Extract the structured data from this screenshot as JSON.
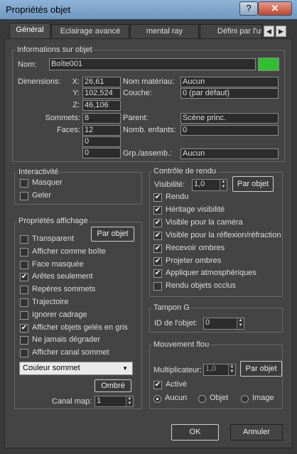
{
  "window": {
    "title": "Propriétés objet",
    "help_label": "?",
    "close_label": "✕"
  },
  "tabs": [
    {
      "label": "Général"
    },
    {
      "label": "Eclairage avancé"
    },
    {
      "label": "mental ray"
    },
    {
      "label": "Défini par l'ut"
    }
  ],
  "tab_scroll": {
    "left": "◀",
    "right": "▶"
  },
  "info": {
    "legend": "Informations sur objet",
    "name_label": "Nom:",
    "name_value": "Boîte001",
    "object_color": "#30c030",
    "dimensions_label": "Dimensions:",
    "x_label": "X:",
    "x_value": "26,61",
    "y_label": "Y:",
    "y_value": "102,524",
    "z_label": "Z:",
    "z_value": "46,106",
    "vertices_label": "Sommets:",
    "vertices_value": "8",
    "faces_label": "Faces:",
    "faces_value": "12",
    "extra1_value": "0",
    "extra2_value": "0",
    "material_label": "Nom matériau:",
    "material_value": "Aucun",
    "layer_label": "Couche:",
    "layer_value": "0 (par défaut)",
    "parent_label": "Parent:",
    "parent_value": "Scène princ.",
    "children_label": "Nomb. enfants:",
    "children_value": "0",
    "group_label": "Grp./assemb.:",
    "group_value": "Aucun"
  },
  "interactivity": {
    "legend": "Interactivité",
    "items": [
      {
        "label": "Masquer",
        "checked": false
      },
      {
        "label": "Geler",
        "checked": false
      }
    ]
  },
  "display": {
    "legend": "Propriétés affichage",
    "by_object_label": "Par objet",
    "items": [
      {
        "label": "Transparent",
        "checked": false
      },
      {
        "label": "Afficher comme boîte",
        "checked": false
      },
      {
        "label": "Face masquée",
        "checked": false
      },
      {
        "label": "Arêtes seulement",
        "checked": true
      },
      {
        "label": "Repères sommets",
        "checked": false
      },
      {
        "label": "Trajectoire",
        "checked": false
      },
      {
        "label": "Ignorer cadrage",
        "checked": false
      },
      {
        "label": "Afficher objets gelés en gris",
        "checked": true
      },
      {
        "label": "Ne jamais dégrader",
        "checked": false
      },
      {
        "label": "Afficher canal sommet",
        "checked": false
      }
    ],
    "vertex_channel_selected": "Couleur sommet",
    "shaded_label": "Ombré",
    "map_channel_label": "Canal map:",
    "map_channel_value": "1"
  },
  "render": {
    "legend": "Contrôle de rendu",
    "visibility_label": "Visibilité:",
    "visibility_value": "1,0",
    "by_object_label": "Par objet",
    "items": [
      {
        "label": "Rendu",
        "checked": true
      },
      {
        "label": "Héritage visibilité",
        "checked": true
      },
      {
        "label": "Visible pour la caméra",
        "checked": true
      },
      {
        "label": "Visible pour la réflexion/réfraction",
        "checked": true
      },
      {
        "label": "Recevoir ombres",
        "checked": true
      },
      {
        "label": "Projeter ombres",
        "checked": true
      },
      {
        "label": "Appliquer atmosphériques",
        "checked": true
      },
      {
        "label": "Rendu objets occlus",
        "checked": false
      }
    ]
  },
  "gbuffer": {
    "legend": "Tampon G",
    "id_label": "ID de l'objet:",
    "id_value": "0"
  },
  "motion_blur": {
    "legend": "Mouvement flou",
    "multiplier_label": "Multiplicateur:",
    "multiplier_value": "1,0",
    "by_object_label": "Par objet",
    "active_label": "Activé",
    "active_checked": true,
    "options": [
      {
        "label": "Aucun",
        "selected": true
      },
      {
        "label": "Objet",
        "selected": false
      },
      {
        "label": "Image",
        "selected": false
      }
    ]
  },
  "footer": {
    "ok_label": "OK",
    "cancel_label": "Annuler"
  }
}
